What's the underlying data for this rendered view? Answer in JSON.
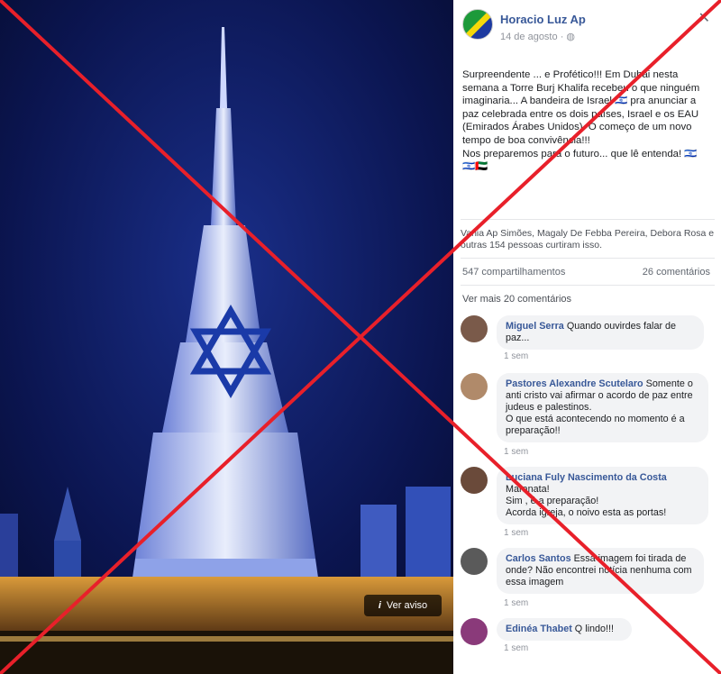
{
  "post": {
    "author": "Horacio Luz Ap",
    "date": "14 de agosto",
    "lines": [
      "Surpreendente ... e Profético!!! Em Dubai nesta",
      "semana a Torre Burj Khalifa recebeu o que ninguém",
      "imaginaria... A bandeira de Israel 🇮🇱 pra anunciar a",
      "paz celebrada entre os dois países, Israel e os EAU",
      "(Emirados Árabes Unidos). O começo de um novo",
      "tempo de boa convivência!!!",
      "Nos preparemos para o futuro... que lê entenda! 🇮🇱",
      "🇮🇱🇦🇪"
    ]
  },
  "reactions": {
    "text": "Vania Ap Simões, Magaly De Febba Pereira, Debora Rosa e outras 154 pessoas curtiram isso."
  },
  "stats": {
    "shares": "547 compartilhamentos",
    "comments": "26 comentários"
  },
  "view_more": "Ver mais 20 comentários",
  "photo": {
    "warning_label": "Ver aviso"
  },
  "comments": [
    {
      "name": "Miguel Serra",
      "lines": [
        "Quando ouvirdes falar de",
        "paz..."
      ],
      "time": "1 sem"
    },
    {
      "name": "Pastores Alexandre Scutelaro",
      "lines": [
        "Somente o",
        "anti cristo vai afirmar o acordo de paz entre",
        "judeus e palestinos.",
        "O que está acontecendo no momento é a",
        "preparação!!"
      ],
      "time": "1 sem"
    },
    {
      "name": "Luciana Fuly Nascimento da Costa",
      "lines": [
        "Maranata!",
        "Sim , é a preparação!",
        "Acorda igreja, o noivo esta as portas!"
      ],
      "time": "1 sem"
    },
    {
      "name": "Carlos Santos",
      "lines": [
        "Essa imagem foi tirada de",
        "onde? Não encontrei notícia nenhuma com",
        "essa imagem"
      ],
      "time": "1 sem"
    },
    {
      "name": "Edinéa Thabet",
      "lines": [
        "Q lindo!!!"
      ],
      "time": "1 sem"
    }
  ],
  "colors": {
    "link": "#385898",
    "cross": "#e8202a",
    "bubble": "#f2f3f5"
  }
}
